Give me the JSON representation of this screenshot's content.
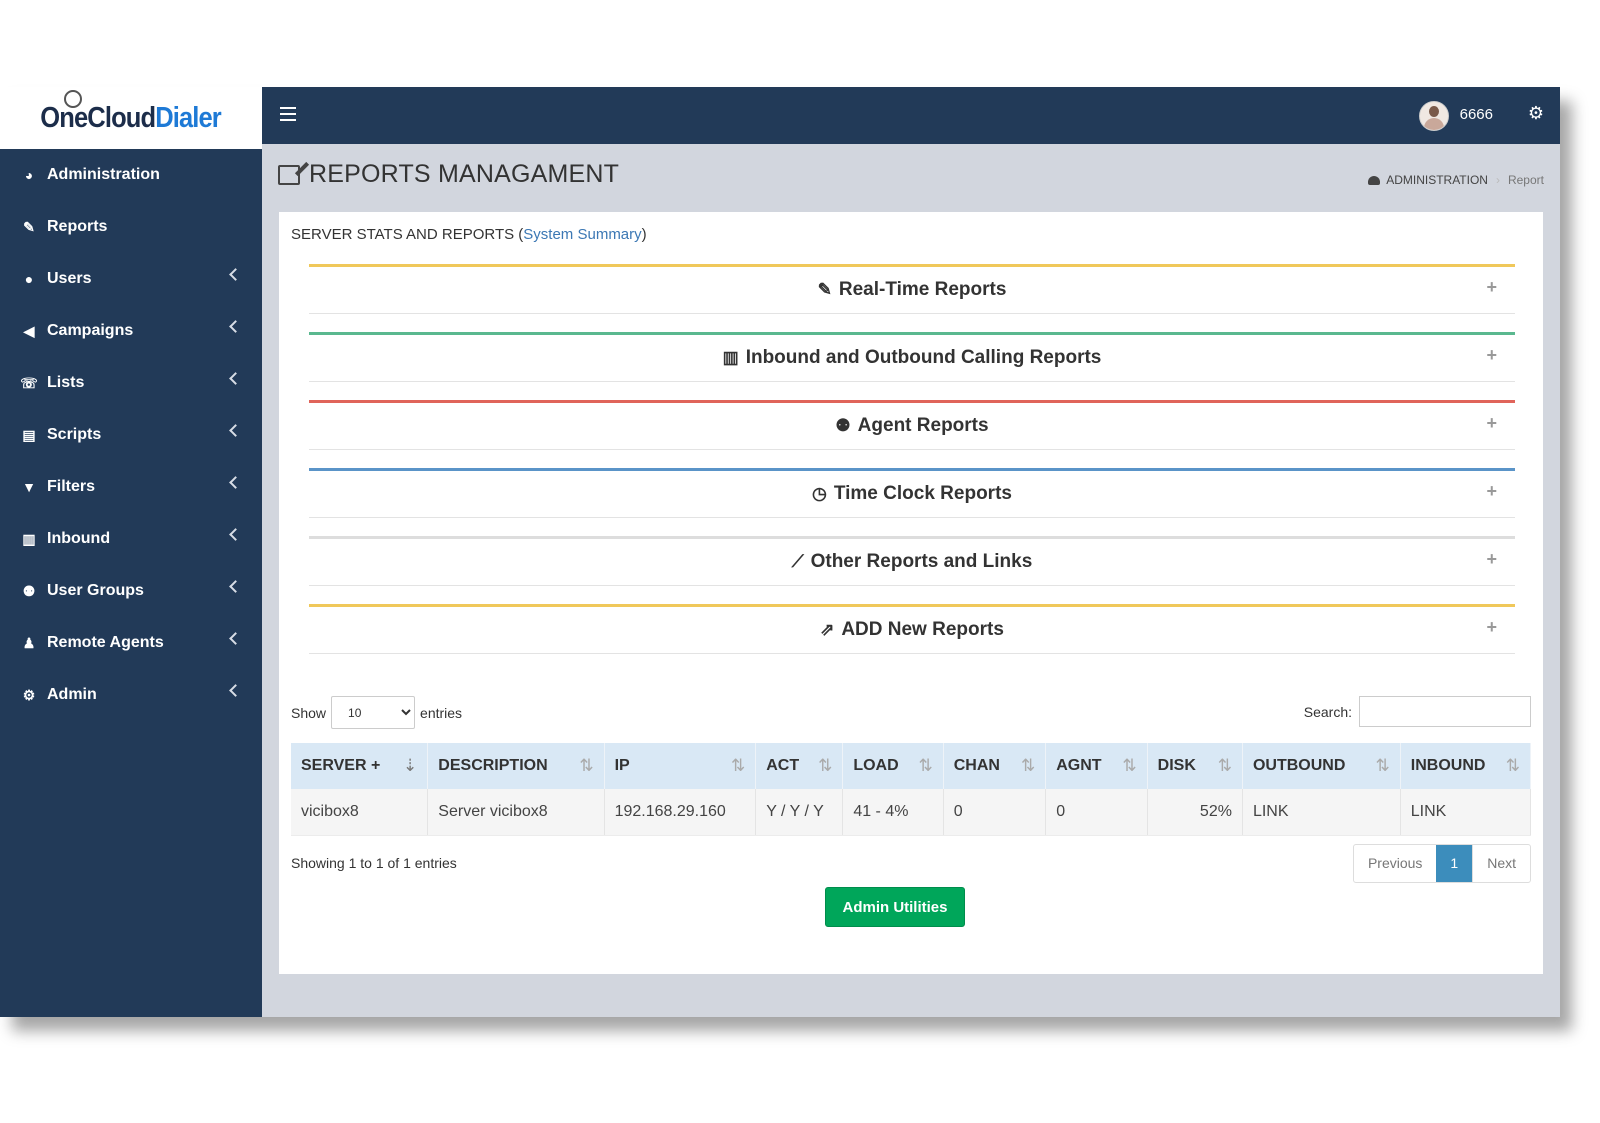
{
  "logo": {
    "part1": "One",
    "part2": "Cloud",
    "part3": "Dialer"
  },
  "topbar": {
    "username": "6666"
  },
  "sidebar": {
    "items": [
      {
        "label": "Administration",
        "icon": "dashboard-icon",
        "chevron": false
      },
      {
        "label": "Reports",
        "icon": "edit-icon",
        "chevron": false
      },
      {
        "label": "Users",
        "icon": "user-icon",
        "chevron": true
      },
      {
        "label": "Campaigns",
        "icon": "bullhorn-icon",
        "chevron": true
      },
      {
        "label": "Lists",
        "icon": "phone-icon",
        "chevron": true
      },
      {
        "label": "Scripts",
        "icon": "file-text-icon",
        "chevron": true
      },
      {
        "label": "Filters",
        "icon": "filter-icon",
        "chevron": true
      },
      {
        "label": "Inbound",
        "icon": "bar-chart-icon",
        "chevron": true
      },
      {
        "label": "User Groups",
        "icon": "users-icon",
        "chevron": true
      },
      {
        "label": "Remote Agents",
        "icon": "agent-icon",
        "chevron": true
      },
      {
        "label": "Admin",
        "icon": "gear-icon",
        "chevron": true
      }
    ]
  },
  "page": {
    "title": "REPORTS MANAGAMENT",
    "breadcrumb": {
      "root": "ADMINISTRATION",
      "current": "Report"
    }
  },
  "box": {
    "title": "SERVER STATS AND REPORTS",
    "title_link": "System Summary",
    "sections": [
      {
        "label": "Real-Time Reports",
        "icon": "edit-icon",
        "color": "#f0c85a"
      },
      {
        "label": "Inbound and Outbound Calling Reports",
        "icon": "bar-chart-icon",
        "color": "#5ab88f"
      },
      {
        "label": "Agent Reports",
        "icon": "users-icon",
        "color": "#e0645a"
      },
      {
        "label": "Time Clock Reports",
        "icon": "clock-icon",
        "color": "#5a94c8"
      },
      {
        "label": "Other Reports and Links",
        "icon": "line-chart-icon",
        "color": "#dddddd"
      },
      {
        "label": "ADD New Reports",
        "icon": "external-link-icon",
        "color": "#f0c85a"
      }
    ]
  },
  "table": {
    "show_label": "Show",
    "entries_label": "entries",
    "page_length": "10",
    "search_label": "Search:",
    "columns": [
      "SERVER +",
      "DESCRIPTION",
      "IP",
      "ACT",
      "LOAD",
      "CHAN",
      "AGNT",
      "DISK",
      "OUTBOUND",
      "INBOUND"
    ],
    "rows": [
      [
        "vicibox8",
        "Server vicibox8",
        "192.168.29.160",
        "Y / Y / Y",
        "41 - 4%",
        "0",
        "0",
        "52%",
        "LINK",
        "LINK"
      ]
    ],
    "info": "Showing 1 to 1 of 1 entries",
    "pager": {
      "previous": "Previous",
      "current": "1",
      "next": "Next"
    }
  },
  "admin_button": "Admin Utilities"
}
